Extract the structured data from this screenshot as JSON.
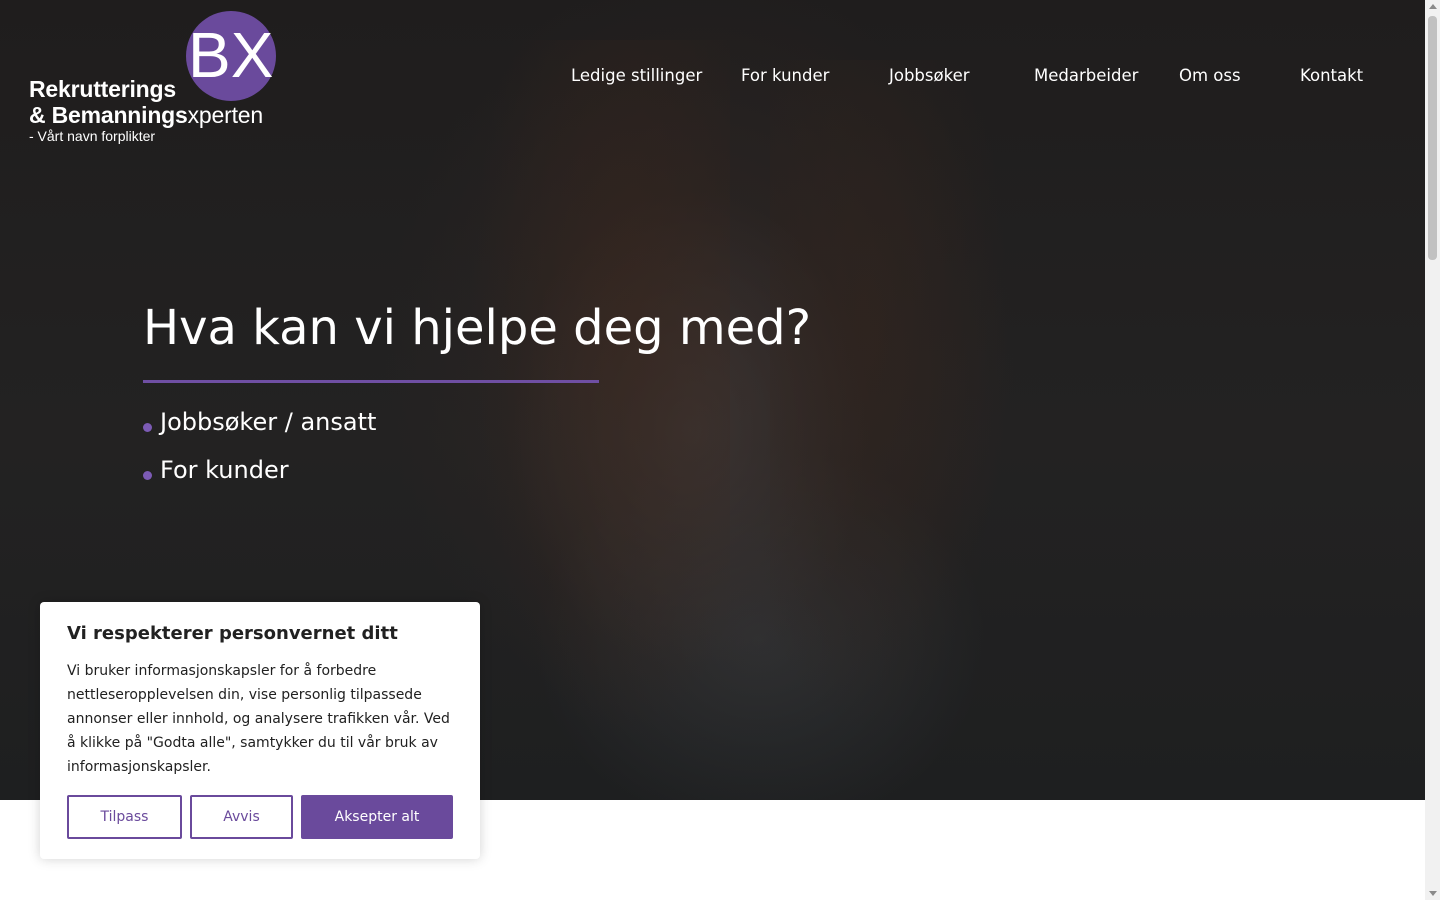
{
  "brand": {
    "logo_letters": "BX",
    "line1": "Rekrutterings",
    "line2_bold": "& Bemannings",
    "line2_light": "xperten",
    "tagline": "- Vårt navn forplikter",
    "color": "#6a4a9c"
  },
  "nav": {
    "items": [
      {
        "label": "Ledige stillinger"
      },
      {
        "label": "For kunder"
      },
      {
        "label": "Jobbsøker"
      },
      {
        "label": "Medarbeider"
      },
      {
        "label": "Om oss"
      },
      {
        "label": "Kontakt"
      }
    ]
  },
  "hero": {
    "title": "Hva kan vi hjelpe deg med?",
    "links": [
      {
        "label": "Jobbsøker / ansatt"
      },
      {
        "label": "For kunder"
      }
    ],
    "accent": "#6f4fa3"
  },
  "cookie": {
    "title": "Vi respekterer personvernet ditt",
    "text": "Vi bruker informasjonskapsler for å forbedre nettleseropplevelsen din, vise personlig tilpassede annonser eller innhold, og analysere trafikken vår. Ved å klikke på \"Godta alle\", samtykker du til vår bruk av informasjonskapsler.",
    "buttons": {
      "customize": "Tilpass",
      "reject": "Avvis",
      "accept": "Aksepter alt"
    }
  }
}
